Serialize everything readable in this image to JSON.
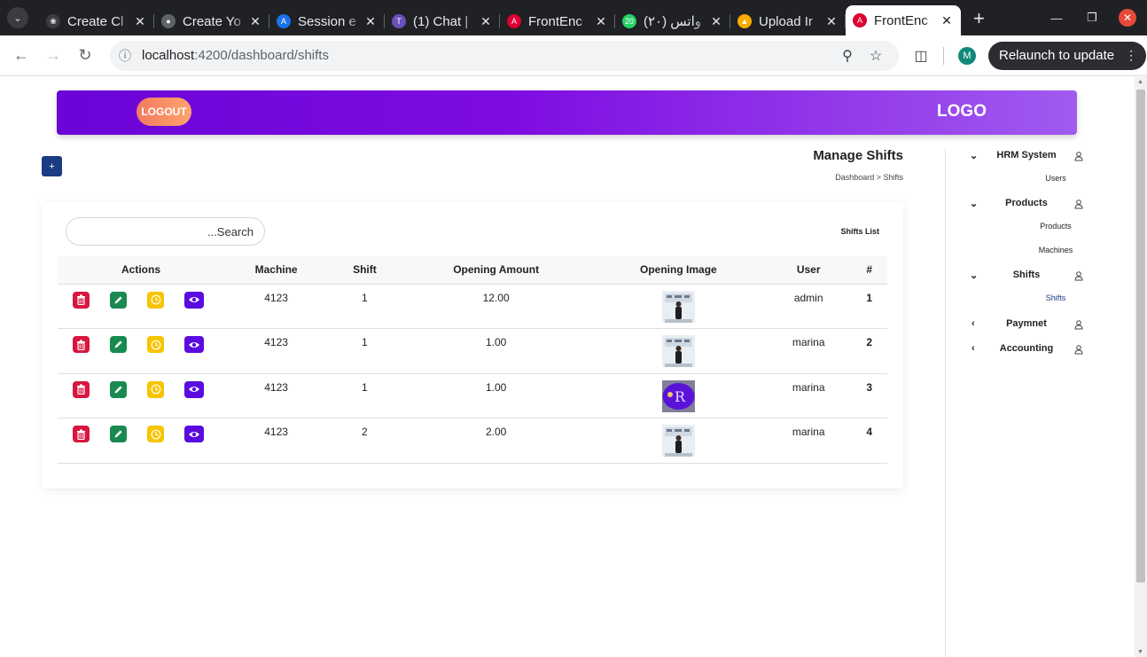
{
  "browser": {
    "tabs": [
      {
        "title": "Create Cl",
        "favicon_color": "#3c3c3f",
        "icon": "openai-icon"
      },
      {
        "title": "Create Yo",
        "favicon_color": "#5f6368",
        "icon": "globe-icon"
      },
      {
        "title": "Session e",
        "favicon_color": "#1a73e8",
        "icon": "azure-icon"
      },
      {
        "title": "(1) Chat |",
        "favicon_color": "#6b4fbb",
        "icon": "teams-icon"
      },
      {
        "title": "FrontEnc",
        "favicon_color": "#dd0031",
        "icon": "angular-icon"
      },
      {
        "title": "(٢٠) واتس",
        "favicon_color": "#25d366",
        "icon": "whatsapp-icon",
        "badge": "20"
      },
      {
        "title": "Upload Ir",
        "favicon_color": "#f9ab00",
        "icon": "upload-icon"
      },
      {
        "title": "FrontEnc",
        "favicon_color": "#dd0031",
        "icon": "angular-icon",
        "active": true
      }
    ],
    "url_host": "localhost",
    "url_path": ":4200/dashboard/shifts",
    "profile_initial": "M",
    "relaunch_label": "Relaunch to update"
  },
  "header": {
    "logout_label": "LOGOUT",
    "logo_label": "LOGO"
  },
  "page": {
    "add_label": "+",
    "title": "Manage Shifts",
    "breadcrumb": "Dashboard > Shifts",
    "search_placeholder": "...Search",
    "list_title": "Shifts List"
  },
  "table": {
    "columns": [
      "Actions",
      "Machine",
      "Shift",
      "Opening Amount",
      "Opening Image",
      "User",
      "#"
    ],
    "rows": [
      {
        "machine": "4123",
        "shift": "1",
        "amount": "12.00",
        "image": "person-photo",
        "user": "admin",
        "num": "1"
      },
      {
        "machine": "4123",
        "shift": "1",
        "amount": "1.00",
        "image": "person-photo",
        "user": "marina",
        "num": "2"
      },
      {
        "machine": "4123",
        "shift": "1",
        "amount": "1.00",
        "image": "logo-photo",
        "user": "marina",
        "num": "3"
      },
      {
        "machine": "4123",
        "shift": "2",
        "amount": "2.00",
        "image": "person-photo",
        "user": "marina",
        "num": "4"
      }
    ]
  },
  "sidebar": {
    "groups": [
      {
        "label": "HRM System",
        "expanded": true,
        "items": [
          "Users"
        ]
      },
      {
        "label": "Products",
        "expanded": true,
        "items": [
          "Products",
          "Machines"
        ]
      },
      {
        "label": "Shifts",
        "expanded": true,
        "items": [
          "Shifts"
        ],
        "active_item": "Shifts"
      },
      {
        "label": "Paymnet",
        "expanded": false,
        "items": []
      },
      {
        "label": "Accounting",
        "expanded": false,
        "items": []
      }
    ]
  },
  "colors": {
    "header_start": "#6a04d8",
    "header_end": "#a15af0",
    "delete": "#d8163f",
    "edit": "#188a50",
    "history": "#f6c400",
    "view": "#5a0ce0",
    "active_link": "#1b3b84"
  }
}
